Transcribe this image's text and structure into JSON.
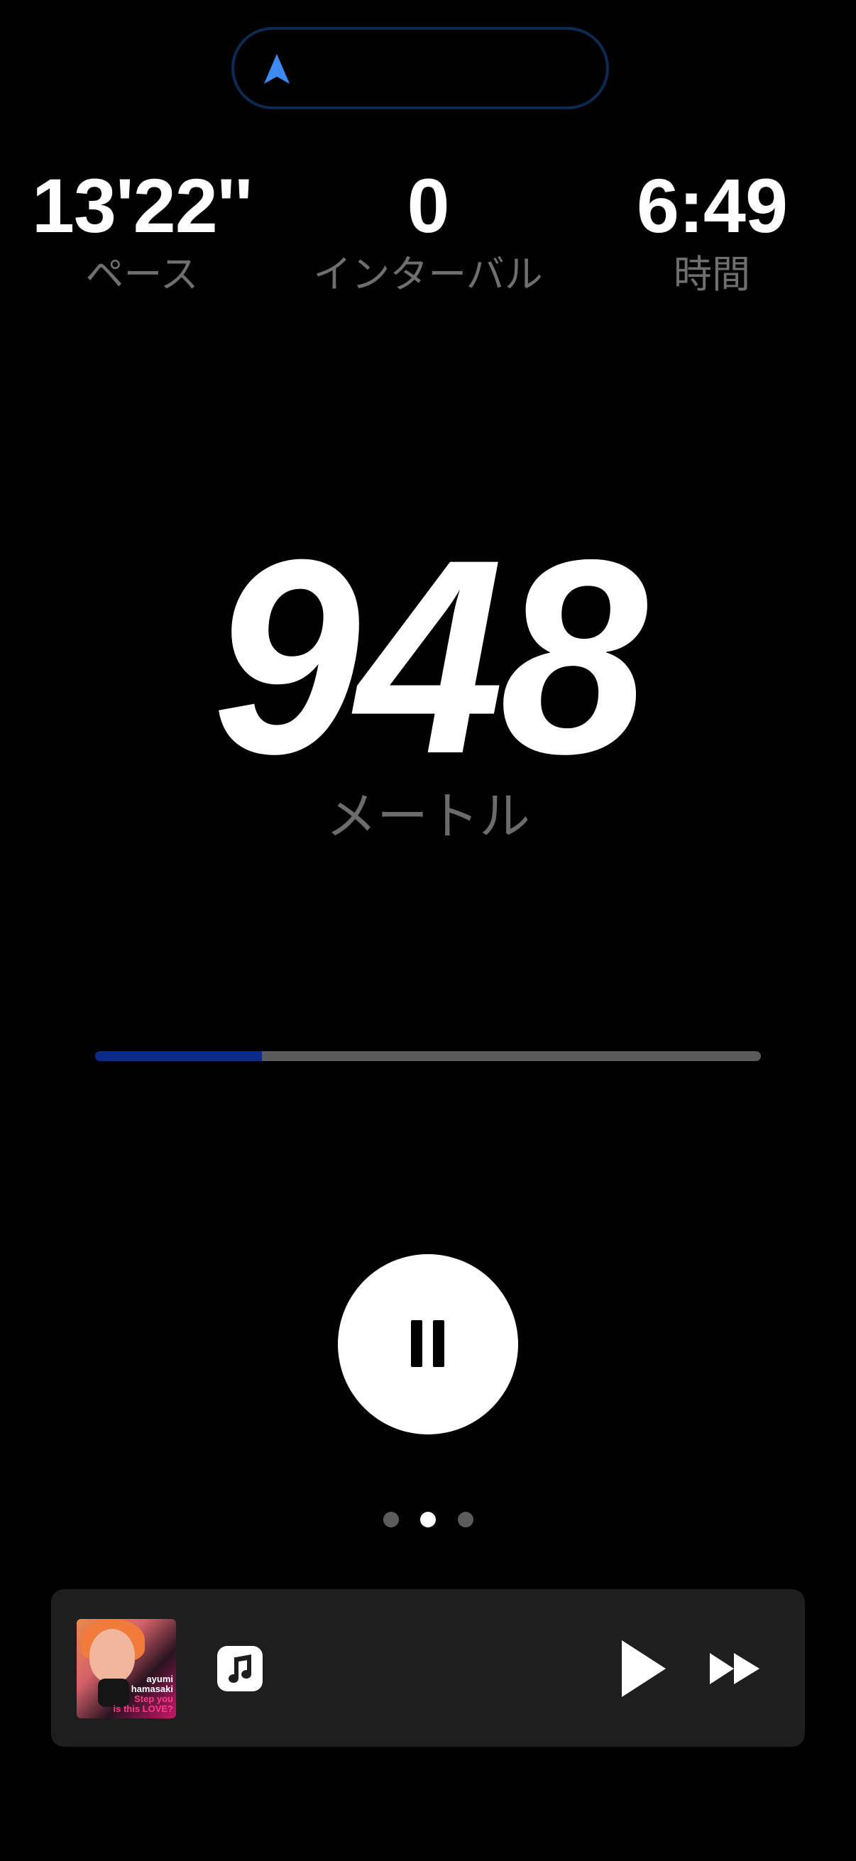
{
  "gps": {
    "icon": "location-arrow-icon",
    "accent_color": "#3d8bf2",
    "border_color": "#0f2a52"
  },
  "stats": {
    "pace": {
      "value": "13'22''",
      "label": "ペース"
    },
    "interval": {
      "value": "0",
      "label": "インターバル"
    },
    "time": {
      "value": "6:49",
      "label": "時間"
    }
  },
  "distance": {
    "value": "948",
    "unit": "メートル"
  },
  "progress": {
    "fraction": 0.25,
    "fill_color": "#0a2a8a",
    "track_color": "#5a5a5a"
  },
  "controls": {
    "pause_icon": "pause-icon"
  },
  "pager": {
    "page_count": 3,
    "current_page": 2
  },
  "player": {
    "album_art_text_line1": "ayumi",
    "album_art_text_line2": "hamasaki",
    "album_art_text_line3": "Step you",
    "album_art_text_line4": "is this LOVE?",
    "app_icon": "music-note-icon",
    "play_icon": "play-icon",
    "next_icon": "fast-forward-icon"
  }
}
